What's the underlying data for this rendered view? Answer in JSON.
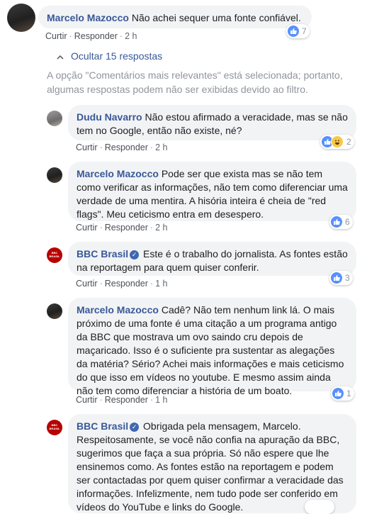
{
  "actions": {
    "like": "Curtir",
    "reply": "Responder",
    "sep": "·"
  },
  "root": {
    "author": "Marcelo Mazocco",
    "text": "Não achei sequer uma fonte confiável.",
    "time": "2 h",
    "likes": "7"
  },
  "hide_replies": "Ocultar 15 respostas",
  "filter_notice": "A opção \"Comentários mais relevantes\" está selecionada; portanto, algumas respostas podem não ser exibidas devido ao filtro.",
  "replies": [
    {
      "author": "Dudu Navarro",
      "text": "Não estou afirmado a veracidade, mas se não tem no Google, então não existe, né?",
      "time": "2 h",
      "reactions": "2"
    },
    {
      "author": "Marcelo Mazocco",
      "text": "Pode ser que exista mas se não tem como verificar as informações, não tem como diferenciar uma verdade de uma mentira. A hisória inteira é cheia de \"red flags\". Meu ceticismo entra em desespero.",
      "time": "2 h",
      "reactions": "6"
    },
    {
      "author": "BBC Brasil",
      "text": "Este é o trabalho do jornalista. As fontes estão na reportagem para quem quiser conferir.",
      "time": "1 h",
      "reactions": "3"
    },
    {
      "author": "Marcelo Mazocco",
      "text": "Cadê? Não tem nenhum link lá. O mais próximo de uma fonte é uma citação a um programa antigo da BBC que mostrava um ovo saindo cru depois de maçaricado. Isso é o suficiente pra sustentar as alegações da matéria? Sério? Achei mais informações e mais ceticismo do que isso em vídeos no youtube. E mesmo assim ainda não tem como diferenciar a história de um boato.",
      "time": "1 h",
      "reactions": "1"
    },
    {
      "author": "BBC Brasil",
      "text": "Obrigada pela mensagem, Marcelo. Respeitosamente, se você não confia na apuração da BBC, sugerimos que faça a sua própria. Só não espere que lhe ensinemos como. As fontes estão na reportagem e podem ser contactadas por quem quiser confirmar a veracidade das informações. Infelizmente, nem tudo pode ser conferido em vídeos do YouTube e links do Google."
    }
  ],
  "bbc_avatar_text": "BBC BRASIL",
  "colors": {
    "author": "#385898",
    "bubble": "#f2f3f5",
    "like": "#5890ff",
    "bbc": "#b80000"
  }
}
